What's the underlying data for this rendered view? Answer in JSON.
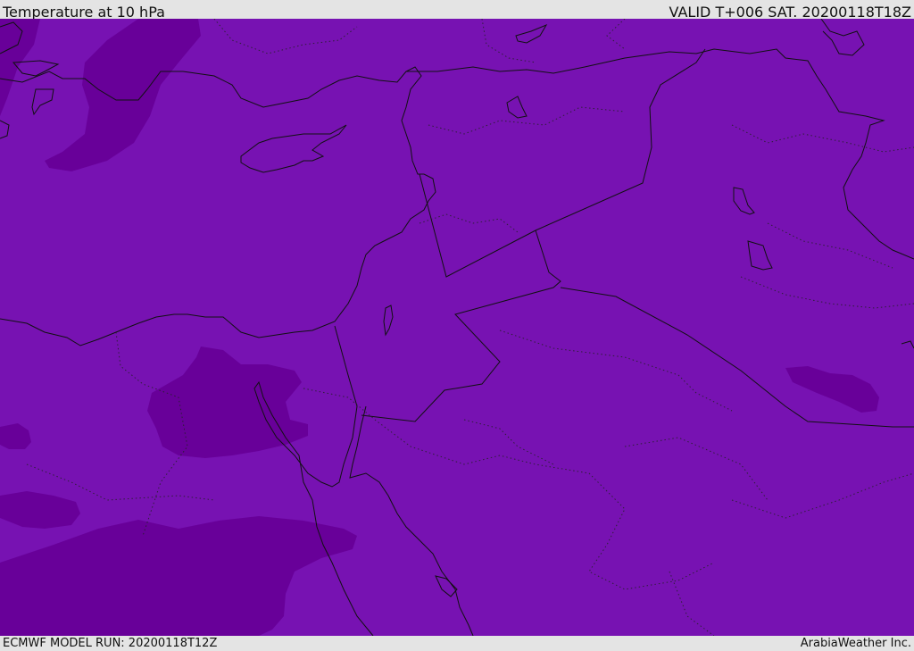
{
  "header": {
    "title": "Temperature at 10 hPa",
    "valid": "VALID T+006 SAT. 20200118T18Z"
  },
  "footer": {
    "model_run": "ECMWF MODEL RUN: 20200118T12Z",
    "credit": "ArabiaWeather Inc."
  },
  "colors": {
    "base_fill": "#7712b2",
    "cold_fill": "#680099",
    "coastline": "#111111",
    "page_bg": "#e4e4e4"
  }
}
